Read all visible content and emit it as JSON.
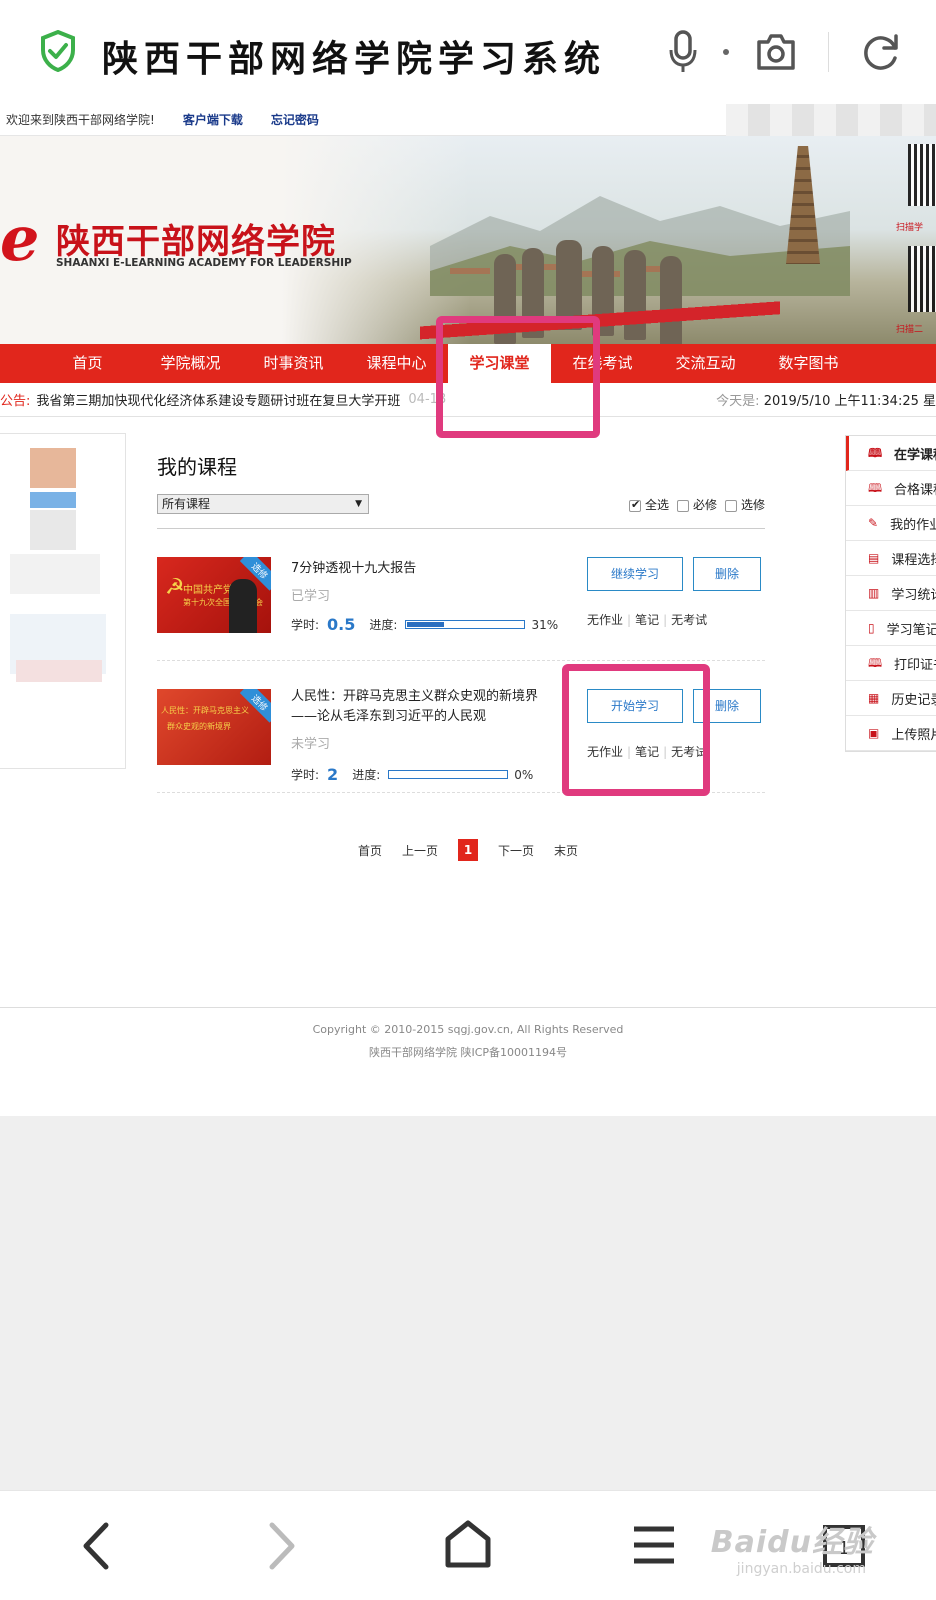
{
  "browser": {
    "title": "陕西干部网络学院学习系统"
  },
  "topbar": {
    "welcome": "欢迎来到陕西干部网络学院!",
    "client_download": "客户端下载",
    "forgot_password": "忘记密码"
  },
  "banner": {
    "logo_cn": "陕西干部网络学院",
    "logo_en": "SHAANXI E-LEARNING ACADEMY FOR LEADERSHIP",
    "qr_label_1": "扫描学",
    "qr_label_2": "扫描二"
  },
  "nav": {
    "items": [
      {
        "label": "首页"
      },
      {
        "label": "学院概况"
      },
      {
        "label": "时事资讯"
      },
      {
        "label": "课程中心"
      },
      {
        "label": "学习课堂"
      },
      {
        "label": "在线考试"
      },
      {
        "label": "交流互动"
      },
      {
        "label": "数字图书"
      }
    ],
    "active_index": 4
  },
  "notice": {
    "label": "公告:",
    "text": "我省第三期加快现代化经济体系建设专题研讨班在复旦大学开班",
    "date_fragment": "04-18",
    "today_label": "今天是:",
    "today_value": "2019/5/10 上午11:34:25 星"
  },
  "courses": {
    "heading": "我的课程",
    "filter": {
      "selected": "所有课程"
    },
    "checks": [
      {
        "label": "全选",
        "checked": true
      },
      {
        "label": "必修",
        "checked": false
      },
      {
        "label": "选修",
        "checked": false
      }
    ],
    "items": [
      {
        "title": "7分钟透视十九大报告",
        "thumb_tag": "选修",
        "thumb_line1": "中国共产党",
        "thumb_line2": "第十九次全国代表大会",
        "state": "已学习",
        "hours_label": "学时:",
        "hours": "0.5",
        "progress_label": "进度:",
        "progress": 31,
        "progress_text": "31%",
        "primary_button": "继续学习",
        "delete_button": "删除",
        "links": [
          "无作业",
          "笔记",
          "无考试"
        ]
      },
      {
        "title": "人民性：开辟马克思主义群众史观的新境界——论从毛泽东到习近平的人民观",
        "thumb_tag": "选修",
        "thumb_line1": "人民性：开辟马克思主义",
        "thumb_line2": "群众史观的新境界",
        "state": "未学习",
        "hours_label": "学时:",
        "hours": "2",
        "progress_label": "进度:",
        "progress": 0,
        "progress_text": "0%",
        "primary_button": "开始学习",
        "delete_button": "删除",
        "links": [
          "无作业",
          "笔记",
          "无考试"
        ]
      }
    ],
    "pager": {
      "first": "首页",
      "prev": "上一页",
      "current": "1",
      "next": "下一页",
      "last": "末页"
    }
  },
  "sidemenu": {
    "items": [
      {
        "label": "在学课程",
        "icon": "book-icon"
      },
      {
        "label": "合格课程",
        "icon": "book-icon"
      },
      {
        "label": "我的作业",
        "icon": "pen-icon"
      },
      {
        "label": "课程选择",
        "icon": "document-icon"
      },
      {
        "label": "学习统计",
        "icon": "chart-icon"
      },
      {
        "label": "学习笔记",
        "icon": "notebook-icon"
      },
      {
        "label": "打印证书",
        "icon": "book-icon"
      },
      {
        "label": "历史记录",
        "icon": "calendar-icon"
      },
      {
        "label": "上传照片",
        "icon": "image-icon"
      }
    ]
  },
  "footer": {
    "copyright": "Copyright © 2010-2015 sqgj.gov.cn, All Rights Reserved",
    "icp": "陕西干部网络学院 陕ICP备10001194号"
  },
  "watermark": {
    "brand": "Baidu经验",
    "url": "jingyan.baidu.com"
  },
  "colors": {
    "brand_red": "#e1261c",
    "link_blue": "#2a78c8",
    "highlight_pink": "#e03a7e",
    "shield_green": "#3cb04a"
  }
}
